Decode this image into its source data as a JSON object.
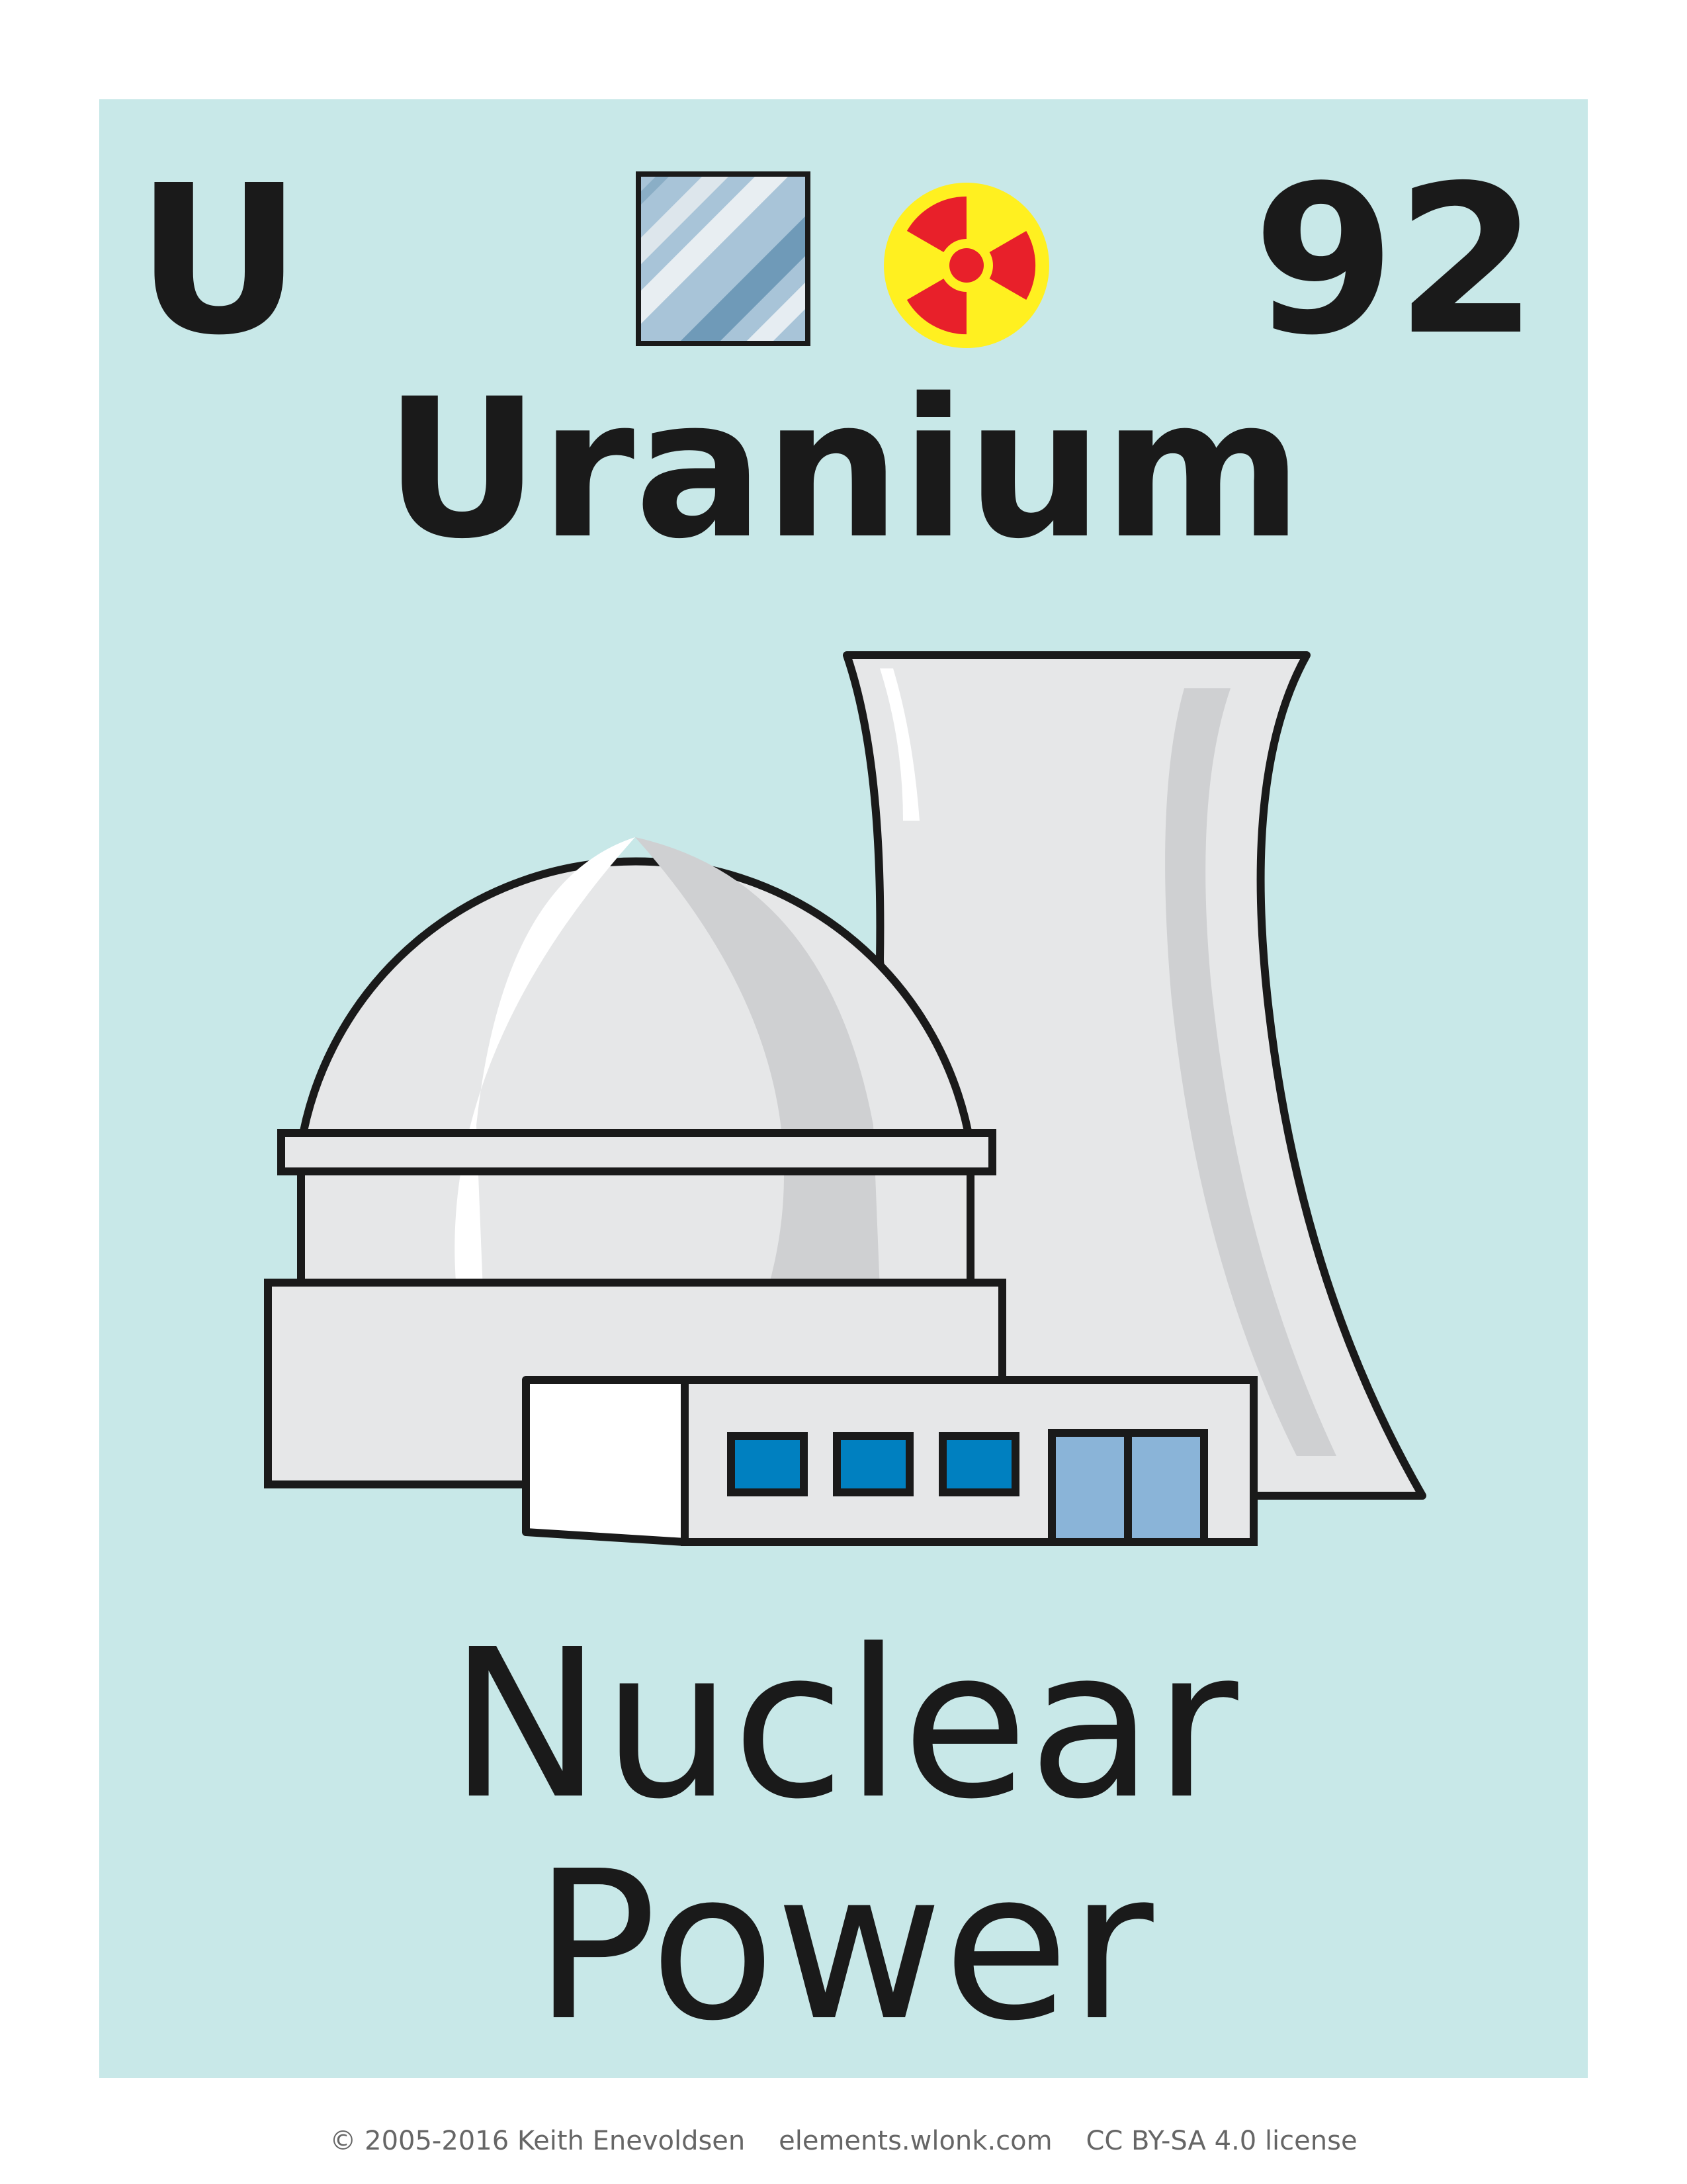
{
  "element": {
    "symbol": "U",
    "atomic_number": "92",
    "name": "Uranium"
  },
  "icons": {
    "state": "solid-metal-icon",
    "hazard": "radioactive-icon"
  },
  "illustration": {
    "subject": "nuclear-power-plant-illustration"
  },
  "use": {
    "line1": "Nuclear",
    "line2": "Power"
  },
  "footer": {
    "copyright": "© 2005-2016 Keith Enevoldsen",
    "website": "elements.wlonk.com",
    "license": "CC BY-SA 4.0 license"
  },
  "colors": {
    "background": "#c8e8e8",
    "radiation_red": "#e8202a",
    "radiation_yellow": "#fff020",
    "window_blue": "#0080c0",
    "door_blue": "#8ab4d8"
  }
}
